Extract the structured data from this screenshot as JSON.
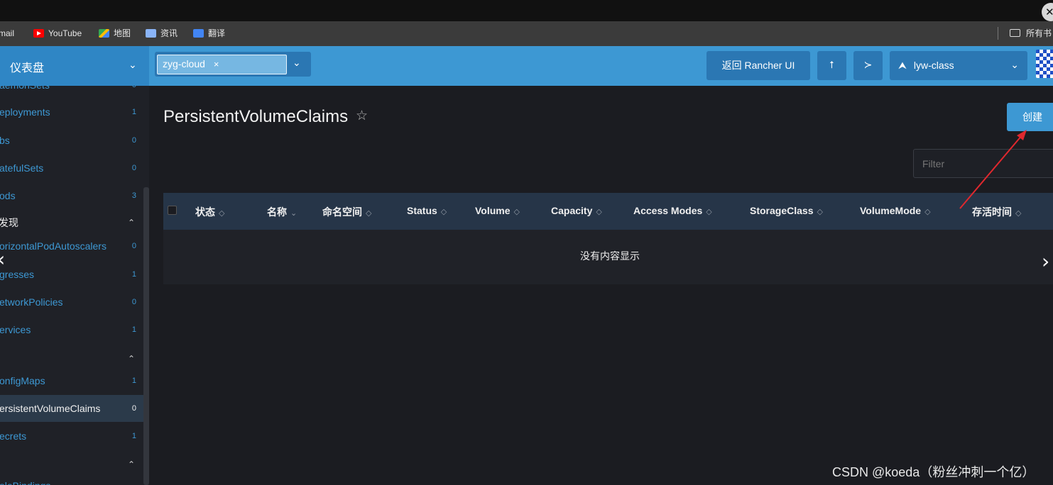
{
  "browser": {
    "bookmarks": [
      {
        "label": "mail",
        "icon": "gmail-icon"
      },
      {
        "label": "YouTube",
        "icon": "youtube-icon"
      },
      {
        "label": "地图",
        "icon": "maps-icon"
      },
      {
        "label": "资讯",
        "icon": "news-icon"
      },
      {
        "label": "翻译",
        "icon": "translate-icon"
      }
    ],
    "all_bookmarks": "所有书",
    "close_glyph": "✕"
  },
  "header": {
    "dashboard_label": "仪表盘",
    "namespace_chip": "zyg-cloud",
    "chip_remove": "×",
    "back_button": "返回 Rancher UI",
    "upload_glyph": "⭡",
    "shell_glyph": "≻",
    "cluster_name": "lyw-class",
    "chevron": "⌄"
  },
  "sidebar": {
    "items": [
      {
        "label": "aemonSets",
        "count": "0"
      },
      {
        "label": "eployments",
        "count": "1"
      },
      {
        "label": "bs",
        "count": "0"
      },
      {
        "label": "atefulSets",
        "count": "0"
      },
      {
        "label": "ods",
        "count": "3"
      },
      {
        "label": "发现",
        "group": true
      },
      {
        "label": "orizontalPodAutoscalers",
        "count": "0"
      },
      {
        "label": "gresses",
        "count": "1"
      },
      {
        "label": "etworkPolicies",
        "count": "0"
      },
      {
        "label": "ervices",
        "count": "1"
      },
      {
        "label": "",
        "group": true
      },
      {
        "label": "onfigMaps",
        "count": "1"
      },
      {
        "label": "ersistentVolumeClaims",
        "count": "0",
        "active": true
      },
      {
        "label": "ecrets",
        "count": "1"
      },
      {
        "label": "",
        "group": true
      },
      {
        "label": "oleBindings",
        "count": ""
      }
    ]
  },
  "main": {
    "title": "PersistentVolumeClaims",
    "star_glyph": "☆",
    "create_button": "创建",
    "filter_placeholder": "Filter",
    "columns": [
      "状态",
      "名称",
      "命名空间",
      "Status",
      "Volume",
      "Capacity",
      "Access Modes",
      "StorageClass",
      "VolumeMode",
      "存活时间"
    ],
    "empty_message": "没有内容显示"
  },
  "nav": {
    "prev": "‹",
    "next": "›"
  },
  "watermark": "CSDN @koeda（粉丝冲刺一个亿）",
  "colors": {
    "accent": "#3d98d3",
    "annotation_arrow": "#e0282e"
  }
}
